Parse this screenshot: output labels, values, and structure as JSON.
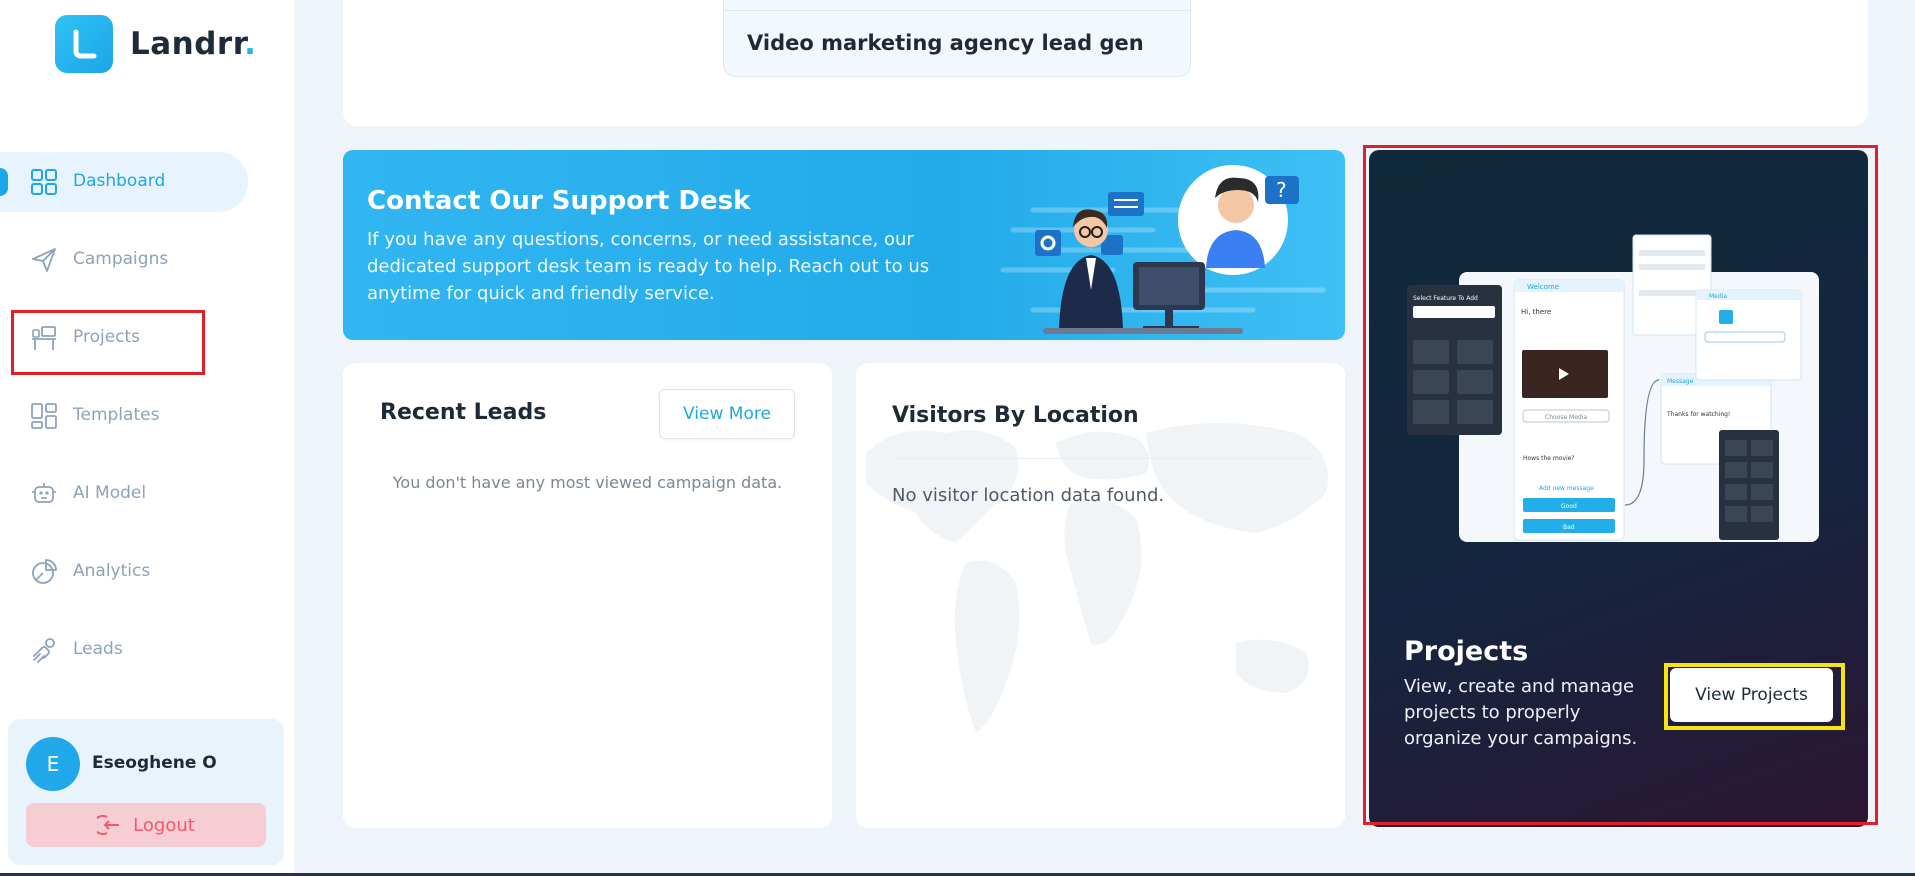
{
  "brand": {
    "name": "Landrr",
    "dot": "."
  },
  "sidebar": {
    "items": [
      {
        "label": "Dashboard",
        "icon": "grid-icon",
        "active": true
      },
      {
        "label": "Campaigns",
        "icon": "paper-plane-icon"
      },
      {
        "label": "Projects",
        "icon": "desk-icon"
      },
      {
        "label": "Templates",
        "icon": "template-icon"
      },
      {
        "label": "AI Model",
        "icon": "robot-icon"
      },
      {
        "label": "Analytics",
        "icon": "pie-chart-icon"
      },
      {
        "label": "Leads",
        "icon": "leads-icon"
      }
    ]
  },
  "user": {
    "initial": "E",
    "name": "Eseoghene O",
    "logout_label": "Logout"
  },
  "top_campaign": {
    "title": "Video marketing agency lead gen"
  },
  "support": {
    "title": "Contact Our Support Desk",
    "text": "If you have any questions, concerns, or need assistance, our dedicated support desk team is ready to help. Reach out to us anytime for quick and friendly service."
  },
  "recent_leads": {
    "title": "Recent Leads",
    "view_more_label": "View More",
    "empty_text": "You don't have any most viewed campaign data."
  },
  "visitors": {
    "title": "Visitors By Location",
    "empty_text": "No visitor location data found."
  },
  "projects": {
    "title": "Projects",
    "text": "View, create and manage projects to properly organize your campaigns.",
    "button_label": "View Projects",
    "mock": {
      "welcome": "Welcome",
      "greeting": "Hi, there",
      "choose_media": "Choose Media",
      "question": "Hows the movie?",
      "add_message": "Add new message",
      "good": "Good",
      "bad": "Bad",
      "message": "Message",
      "thanks": "Thanks for watching!",
      "media": "Media",
      "select_feature": "Select Feature To Add"
    }
  },
  "colors": {
    "accent": "#1ea7e6",
    "annotation_red": "#e01f26",
    "annotation_yellow": "#f8e410"
  }
}
